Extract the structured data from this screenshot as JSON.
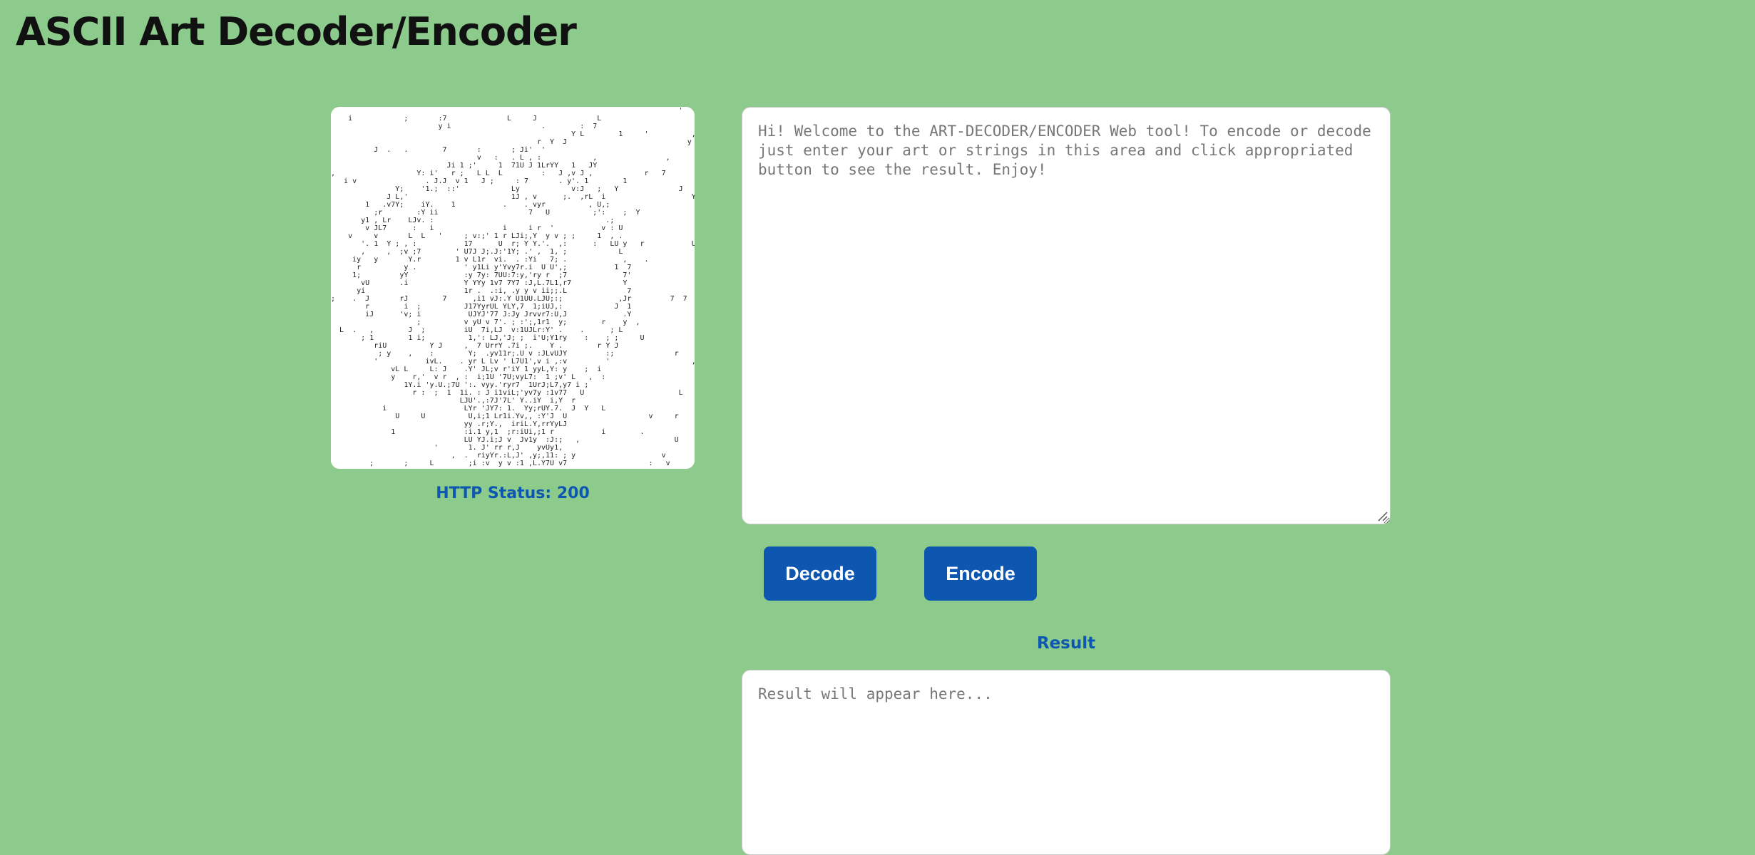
{
  "header": {
    "title": "ASCII Art Decoder/Encoder"
  },
  "art_preview": {
    "description_icon": "ascii-art-image",
    "status_text": "HTTP Status: 200"
  },
  "input": {
    "placeholder": "Hi! Welcome to the ART-DECODER/ENCODER Web tool! To encode or decode just enter your art or strings in this area and click appropriated button to see the result. Enjoy!",
    "value": ""
  },
  "actions": {
    "decode_label": "Decode",
    "encode_label": "Encode"
  },
  "result": {
    "heading": "Result",
    "placeholder": "Result will appear here...",
    "value": ""
  },
  "colors": {
    "background": "#8dcb8c",
    "accent": "#0d57b0",
    "panel": "#ffffff"
  }
}
